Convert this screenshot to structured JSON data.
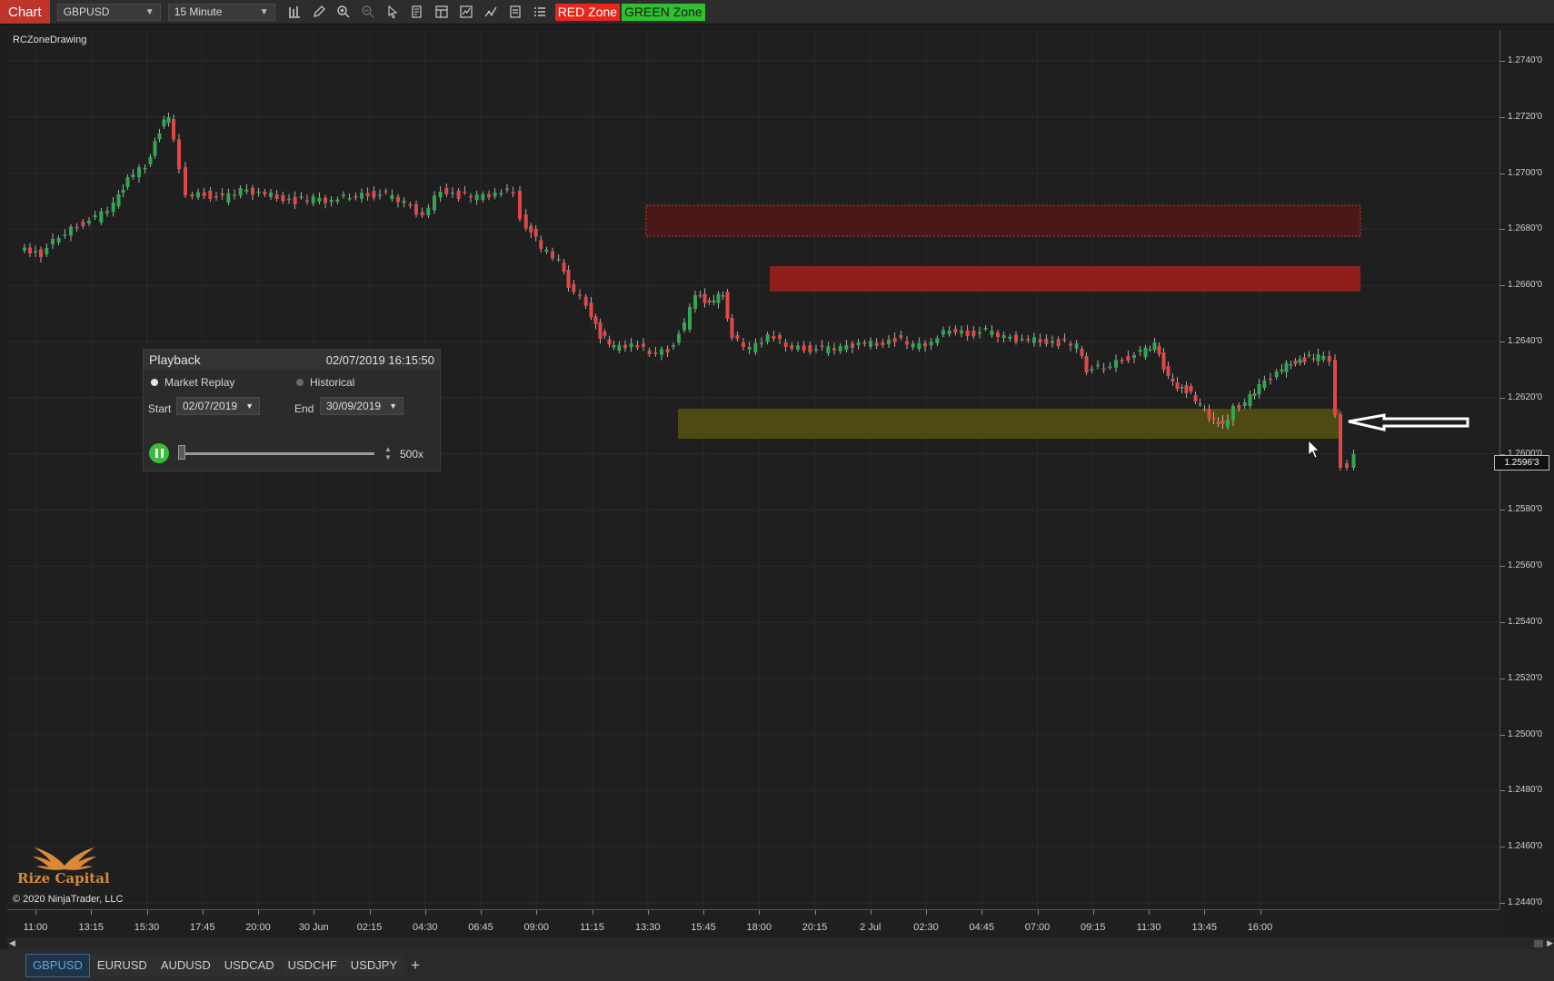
{
  "toolbar": {
    "chart_tab": "Chart",
    "instrument": "GBPUSD",
    "interval": "15 Minute",
    "tool_icons": [
      "bar-chart-icon",
      "pencil-icon",
      "zoom-in-icon",
      "zoom-out-icon",
      "cursor-icon",
      "data-box-icon",
      "properties-icon",
      "indicators-icon",
      "strategies-icon",
      "templates-icon",
      "list-icon"
    ],
    "red_zone": "RED Zone",
    "green_zone": "GREEN Zone"
  },
  "indicator_label": "RCZoneDrawing",
  "price_axis": {
    "labels": [
      "1.2740'0",
      "1.2720'0",
      "1.2700'0",
      "1.2680'0",
      "1.2660'0",
      "1.2640'0",
      "1.2620'0",
      "1.2600'0",
      "1.2580'0",
      "1.2560'0",
      "1.2540'0",
      "1.2520'0",
      "1.2500'0",
      "1.2480'0",
      "1.2460'0",
      "1.2440'0"
    ],
    "current_price": "1.2596'3"
  },
  "time_axis": {
    "labels": [
      "11:00",
      "13:15",
      "15:30",
      "17:45",
      "20:00",
      "30 Jun",
      "02:15",
      "04:30",
      "06:45",
      "09:00",
      "11:15",
      "13:30",
      "15:45",
      "18:00",
      "20:15",
      "2 Jul",
      "02:30",
      "04:45",
      "07:00",
      "09:15",
      "11:30",
      "13:45",
      "16:00"
    ]
  },
  "playback": {
    "title": "Playback",
    "time": "02/07/2019 16:15:50",
    "mode_market_replay": "Market Replay",
    "mode_historical": "Historical",
    "start_label": "Start",
    "start_date": "02/07/2019",
    "end_label": "End",
    "end_date": "30/09/2019",
    "speed": "500x",
    "position": 0
  },
  "logo": {
    "text": "Rize Capital"
  },
  "copyright": "© 2020 NinjaTrader, LLC",
  "instrument_tabs": [
    "GBPUSD",
    "EURUSD",
    "AUDUSD",
    "USDCAD",
    "USDCHF",
    "USDJPY"
  ],
  "add_tab": "+",
  "colors": {
    "bull": "#2fa84f",
    "bear": "#e04848",
    "red_zone_fill": "#8e1f1a",
    "yellow_zone_fill": "#4e4a13"
  }
}
